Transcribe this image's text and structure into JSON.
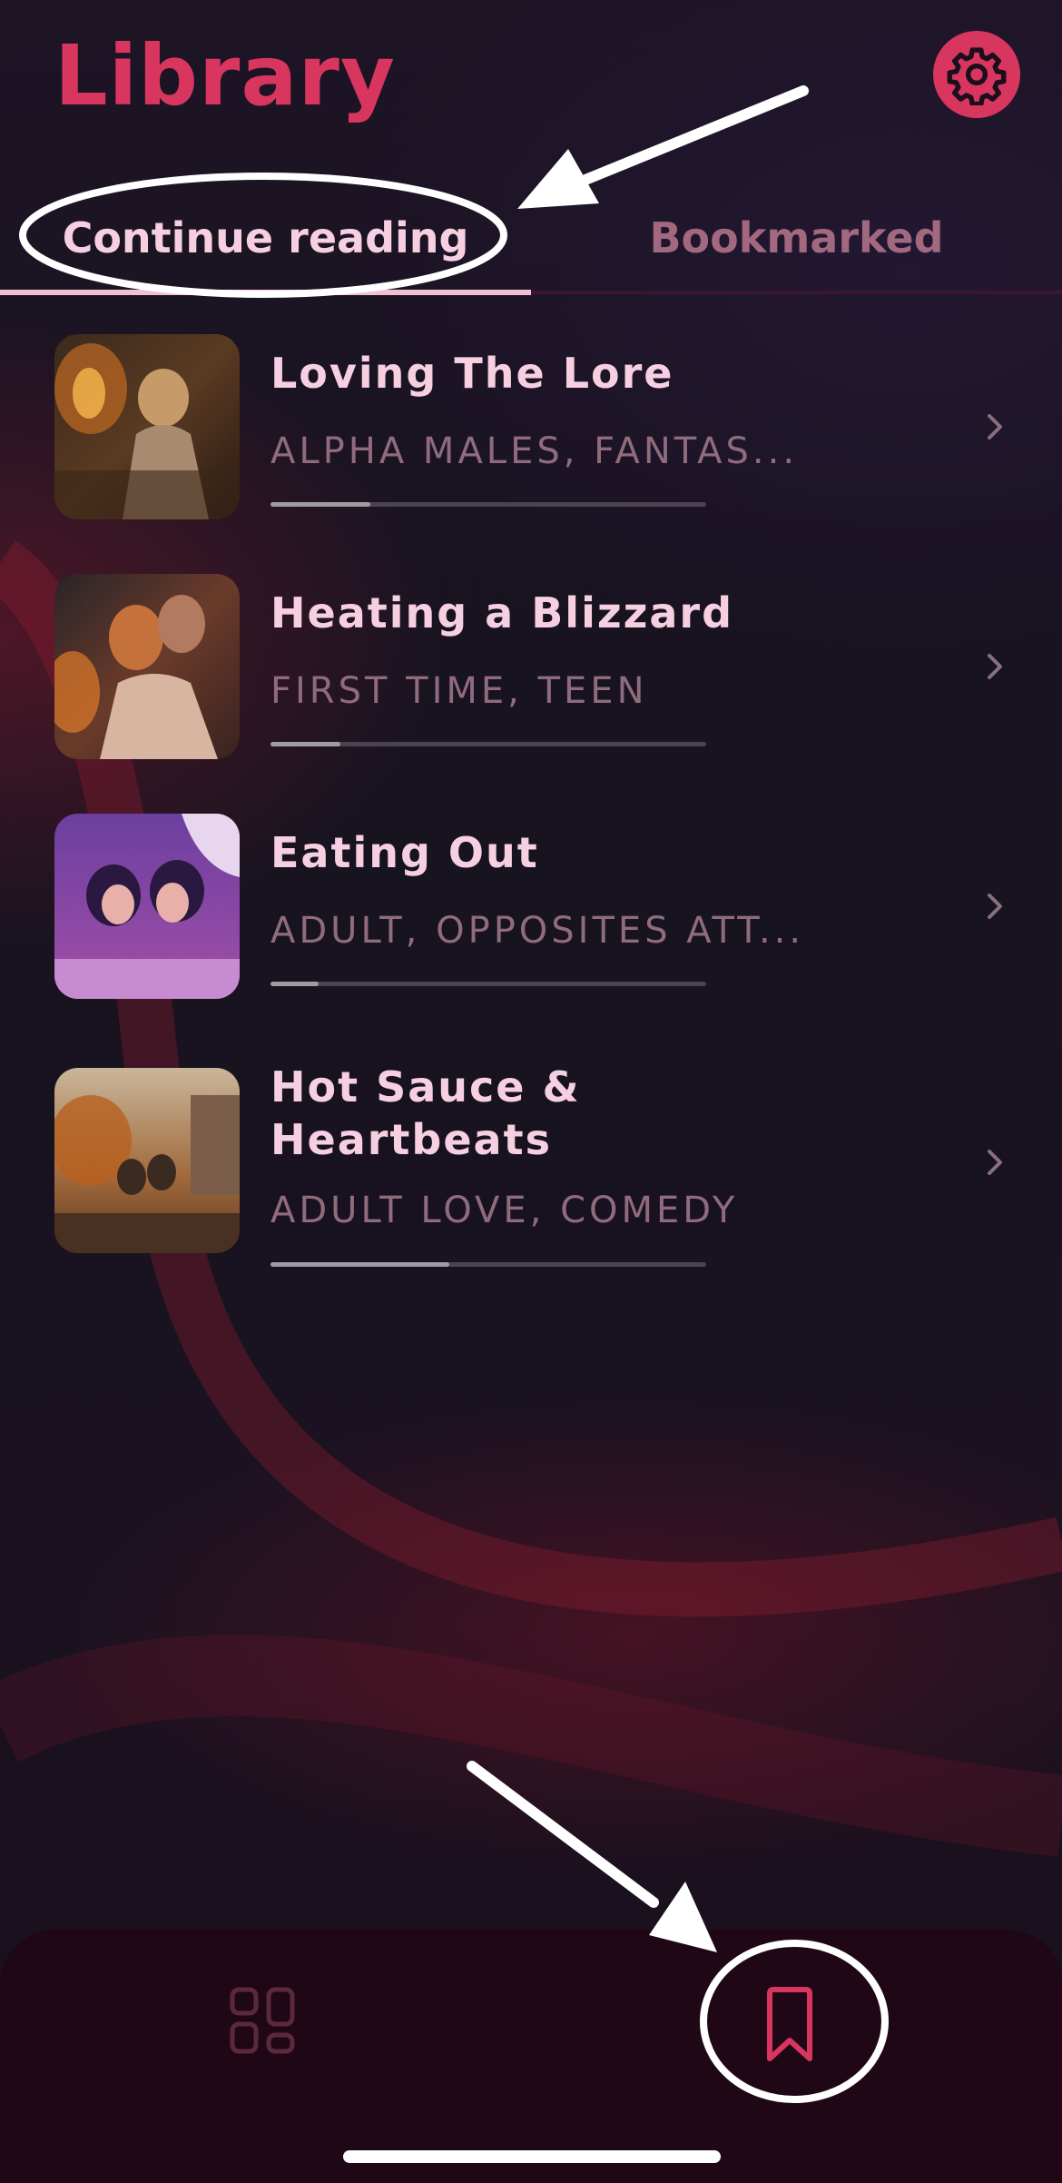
{
  "header": {
    "title": "Library",
    "settings_icon": "gear-icon"
  },
  "tabs": [
    {
      "label": "Continue reading",
      "active": true
    },
    {
      "label": "Bookmarked",
      "active": false
    }
  ],
  "books": [
    {
      "title": "Loving The Lore",
      "tags": "ALPHA MALES, FANTAS...",
      "progress": 0.23
    },
    {
      "title": "Heating a Blizzard",
      "tags": "FIRST TIME, TEEN",
      "progress": 0.16
    },
    {
      "title": "Eating Out",
      "tags": "ADULT, OPPOSITES ATT...",
      "progress": 0.11
    },
    {
      "title": "Hot Sauce & Heartbeats",
      "tags": "ADULT LOVE, COMEDY",
      "progress": 0.41
    }
  ],
  "bottom_nav": [
    {
      "icon": "grid-icon",
      "active": false
    },
    {
      "icon": "bookmark-icon",
      "active": true
    }
  ],
  "colors": {
    "accent": "#d9365f",
    "title_text": "#f6cfe0",
    "tag_text": "#8f6b7c",
    "inactive_tab": "#a1687f"
  }
}
